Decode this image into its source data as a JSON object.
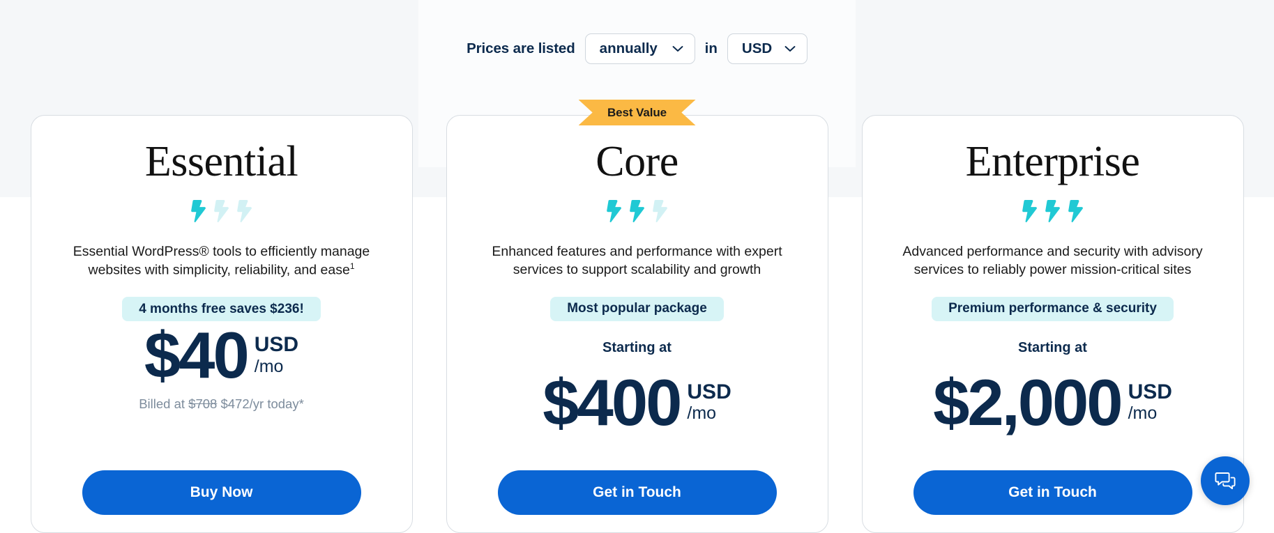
{
  "selector": {
    "label": "Prices are listed",
    "period_value": "annually",
    "mid_label": "in",
    "currency_value": "USD",
    "chevron_icon": "chevron-down-icon"
  },
  "colors": {
    "brand_blue": "#0a65d4",
    "navy": "#0c2a4d",
    "teal": "#20c9d4",
    "teal_faded": "#d2f1f4",
    "ribbon_amber": "#fbb944",
    "badge_bg": "#d7f4f6",
    "muted_text": "#7d8c9c",
    "page_bg_top": "#f5f7f9",
    "card_border": "#d8dde2"
  },
  "ribbon": {
    "label": "Best Value"
  },
  "plans": [
    {
      "name": "Essential",
      "bolts_filled": 1,
      "bolts_total": 3,
      "description": "Essential WordPress® tools to efficiently manage websites with simplicity, reliability, and ease",
      "description_footnote": "1",
      "badge": "4 months free saves $236!",
      "starting_at": "",
      "price": "$40",
      "currency": "USD",
      "per": "/mo",
      "billed_prefix": "Billed at",
      "billed_old": "$708",
      "billed_new": "$472/yr today*",
      "cta": "Buy Now",
      "best_value": false
    },
    {
      "name": "Core",
      "bolts_filled": 2,
      "bolts_total": 3,
      "description": "Enhanced features and performance with expert services to support scalability and growth",
      "description_footnote": "",
      "badge": "Most popular package",
      "starting_at": "Starting at",
      "price": "$400",
      "currency": "USD",
      "per": "/mo",
      "billed_prefix": "",
      "billed_old": "",
      "billed_new": "",
      "cta": "Get in Touch",
      "best_value": true
    },
    {
      "name": "Enterprise",
      "bolts_filled": 3,
      "bolts_total": 3,
      "description": "Advanced performance and security with advisory services to reliably power mission-critical sites",
      "description_footnote": "",
      "badge": "Premium performance & security",
      "starting_at": "Starting at",
      "price": "$2,000",
      "currency": "USD",
      "per": "/mo",
      "billed_prefix": "",
      "billed_old": "",
      "billed_new": "",
      "cta": "Get in Touch",
      "best_value": false
    }
  ],
  "chat": {
    "icon": "chat-bubbles-icon"
  }
}
